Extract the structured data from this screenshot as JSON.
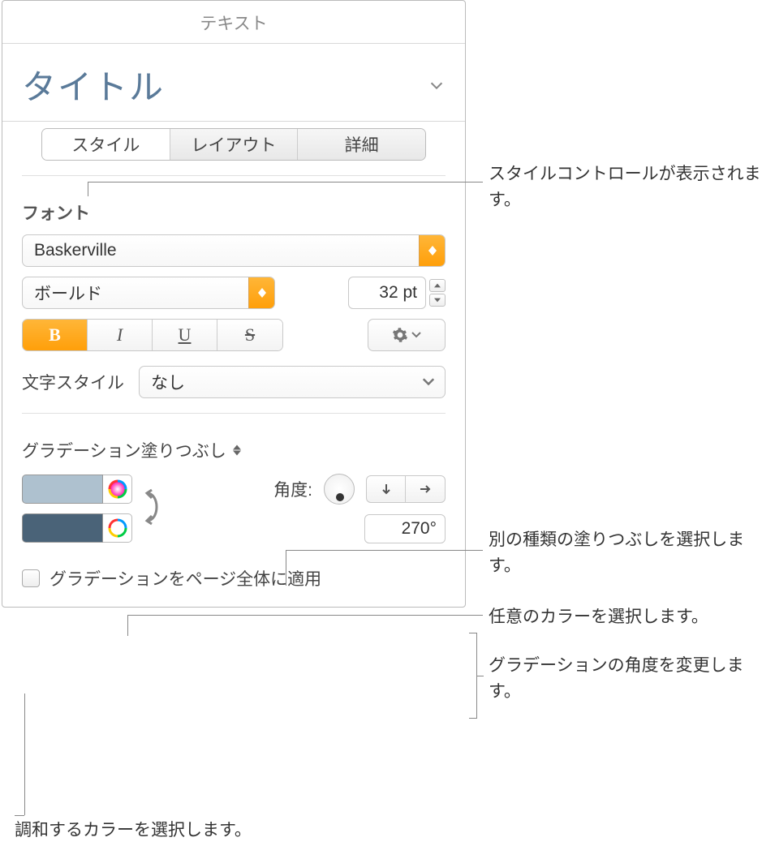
{
  "panel_title": "テキスト",
  "paragraph_style": "タイトル",
  "tabs": {
    "style": "スタイル",
    "layout": "レイアウト",
    "more": "詳細"
  },
  "font": {
    "heading": "フォント",
    "family": "Baskerville",
    "weight": "ボールド",
    "size": "32 pt",
    "bold": "B",
    "italic": "I",
    "underline": "U",
    "strike": "S",
    "char_style_label": "文字スタイル",
    "char_style_value": "なし"
  },
  "fill": {
    "mode": "グラデーション塗りつぶし",
    "angle_label": "角度:",
    "angle_value": "270°",
    "apply_page_label": "グラデーションをページ全体に適用"
  },
  "callouts": {
    "style_controls": "スタイルコントロールが表示されます。",
    "fill_type": "別の種類の塗りつぶしを選択します。",
    "any_color": "任意のカラーを選択します。",
    "angle": "グラデーションの角度を変更します。",
    "harmonize": "調和するカラーを選択します。"
  }
}
